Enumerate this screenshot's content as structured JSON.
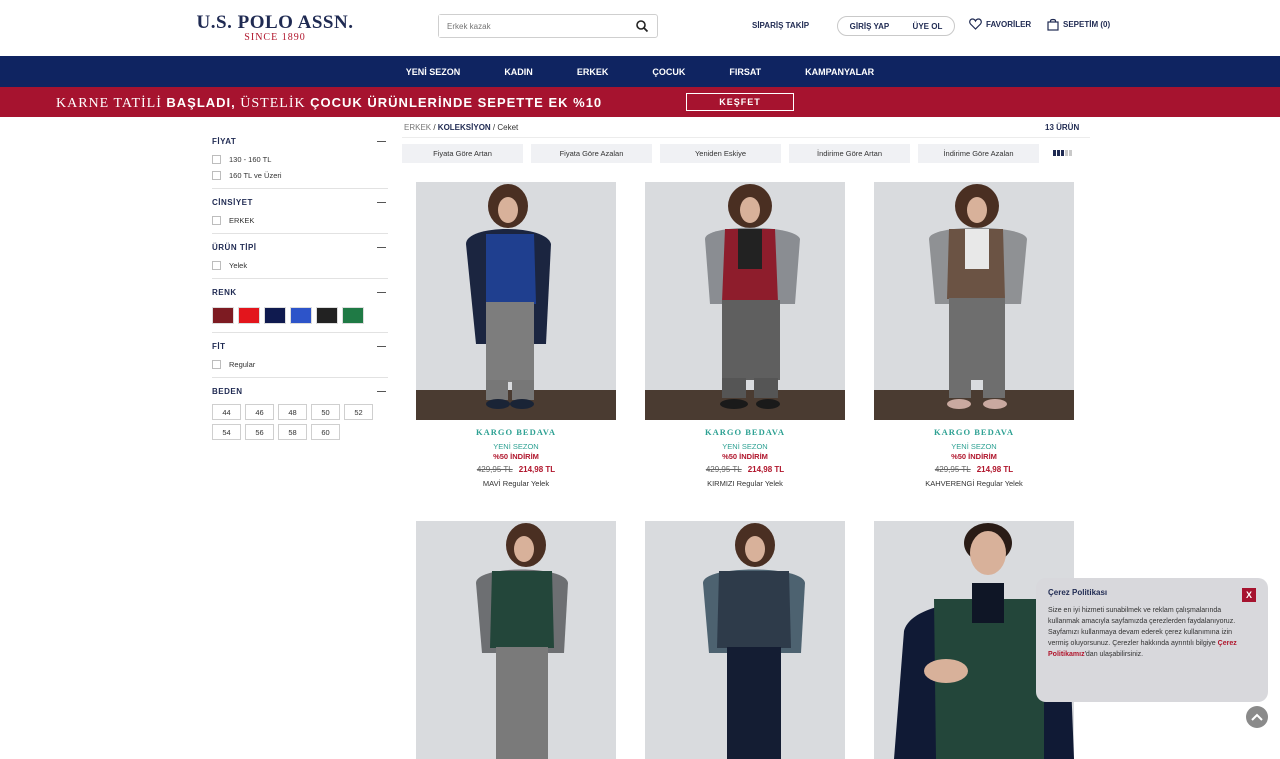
{
  "header": {
    "logo_main": "U.S. POLO ASSN.",
    "logo_sub": "SINCE 1890",
    "search_placeholder": "Erkek kazak",
    "order_track": "SİPARİŞ TAKİP",
    "login": "GİRİŞ YAP",
    "register": "ÜYE OL",
    "favorites": "FAVORİLER",
    "cart": "SEPETİM (0)"
  },
  "nav": {
    "items": [
      "YENİ SEZON",
      "KADIN",
      "ERKEK",
      "ÇOCUK",
      "FIRSAT",
      "KAMPANYALAR"
    ]
  },
  "promo": {
    "text_a": "KARNE TATİLİ ",
    "text_b": "BAŞLADI,",
    "text_c": " ÜSTELİK ",
    "text_d": "ÇOCUK ÜRÜNLERİNDE SEPETTE EK %10",
    "button": "KEŞFET"
  },
  "filters": {
    "price_title": "FİYAT",
    "price_options": [
      "130 - 160 TL",
      "160 TL ve Üzeri"
    ],
    "gender_title": "CİNSİYET",
    "gender_options": [
      "ERKEK"
    ],
    "type_title": "ÜRÜN TİPİ",
    "type_options": [
      "Yelek"
    ],
    "color_title": "RENK",
    "colors": [
      "#7d1b22",
      "#e3151c",
      "#0f1a4f",
      "#2d54c9",
      "#222222",
      "#1f7a45"
    ],
    "fit_title": "FİT",
    "fit_options": [
      "Regular"
    ],
    "size_title": "BEDEN",
    "sizes": [
      "44",
      "46",
      "48",
      "50",
      "52",
      "54",
      "56",
      "58",
      "60"
    ]
  },
  "breadcrumb": {
    "first": "ERKEK",
    "sep": " / ",
    "second": "KOLEKSİYON",
    "third": "Ceket"
  },
  "result_count": "13 ÜRÜN",
  "sort_options": [
    "Fiyata Göre Artan",
    "Fiyata Göre Azalan",
    "Yeniden Eskiye",
    "İndirime Göre Artan",
    "İndirime Göre Azalan"
  ],
  "products": [
    {
      "shipping": "KARGO BEDAVA",
      "season": "YENİ SEZON",
      "discount": "%50 İNDİRİM",
      "old_price": "429,95 TL",
      "new_price": "214,98 TL",
      "name": "MAVİ Regular Yelek",
      "vest_color": "#1f3f8f"
    },
    {
      "shipping": "KARGO BEDAVA",
      "season": "YENİ SEZON",
      "discount": "%50 İNDİRİM",
      "old_price": "429,95 TL",
      "new_price": "214,98 TL",
      "name": "KIRMIZI Regular Yelek",
      "vest_color": "#8e1d2c"
    },
    {
      "shipping": "KARGO BEDAVA",
      "season": "YENİ SEZON",
      "discount": "%50 İNDİRİM",
      "old_price": "429,95 TL",
      "new_price": "214,98 TL",
      "name": "KAHVERENGİ Regular Yelek",
      "vest_color": "#6b5344"
    },
    {
      "vest_color": "#23463a"
    },
    {
      "vest_color": "#2e3b4a"
    },
    {
      "vest_color": "#23463a"
    }
  ],
  "cookie": {
    "title": "Çerez Politikası",
    "body": "Size en iyi hizmeti sunabilmek ve reklam çalışmalarında kullanmak amacıyla sayfamızda çerezlerden faydalanıyoruz. Sayfamızı kullanmaya devam ederek çerez kullanımına izin vermiş oluyorsunuz. Çerezler hakkında ayrıntılı bilgiye ",
    "link": "Çerez Politikamız",
    "tail": "'dan ulaşabilirsiniz.",
    "close": "X"
  }
}
